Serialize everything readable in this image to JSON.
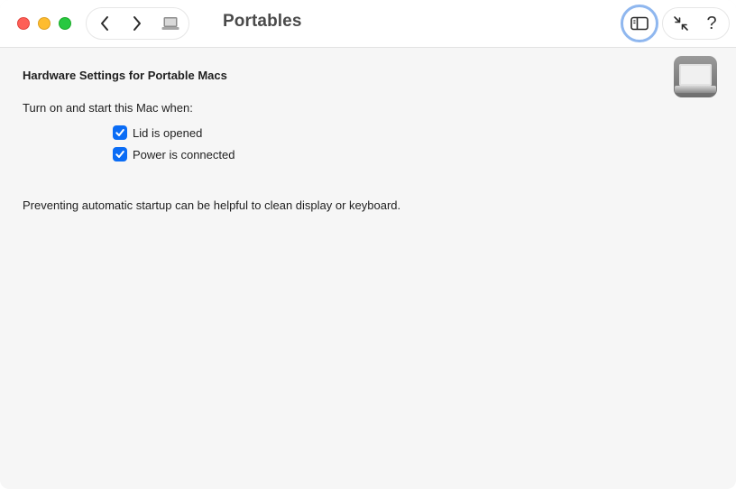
{
  "window": {
    "title": "Portables"
  },
  "toolbar": {
    "back_icon": "chevron-left-icon",
    "forward_icon": "chevron-right-icon",
    "nav_icon": "laptop-icon",
    "sidebar_icon": "sidebar-icon",
    "shrink_icon": "arrows-inward-icon",
    "help_label": "?"
  },
  "content": {
    "heading": "Hardware Settings for Portable Macs",
    "intro": "Turn on and start this Mac when:",
    "options": [
      {
        "label": "Lid is opened",
        "checked": true
      },
      {
        "label": "Power is connected",
        "checked": true
      }
    ],
    "note": "Preventing automatic startup can be helpful to clean display or keyboard."
  },
  "colors": {
    "accent": "#0a6cf5",
    "focus_ring": "#8fb7ef",
    "close": "#fe5f57",
    "minimize": "#febc2e",
    "maximize": "#28c840"
  }
}
